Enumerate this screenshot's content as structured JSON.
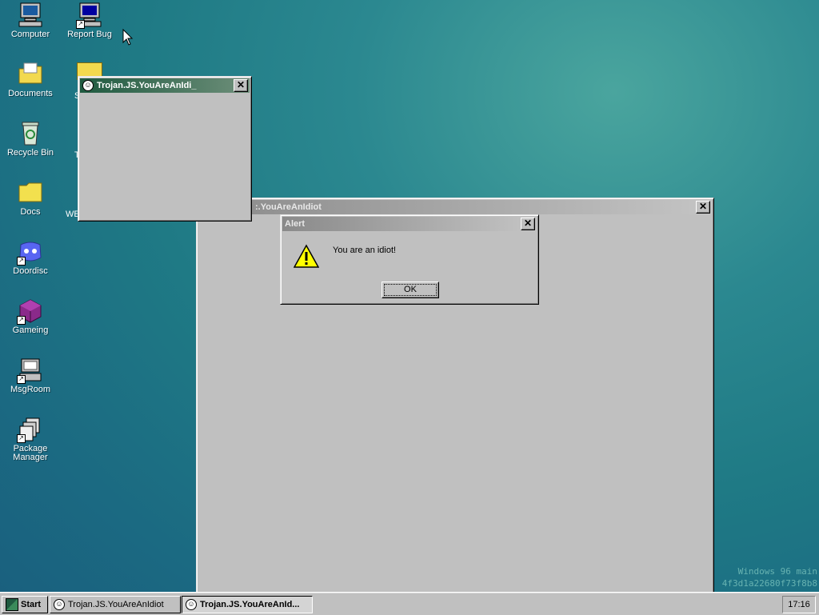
{
  "desktop": {
    "icons": [
      {
        "label": "Computer",
        "icon": "computer-icon"
      },
      {
        "label": "Report Bug",
        "icon": "report-bug-icon"
      },
      {
        "label": "Documents",
        "icon": "documents-folder-icon"
      },
      {
        "label": "Recycle Bin",
        "icon": "recycle-bin-icon"
      },
      {
        "label": "Docs",
        "icon": "folder-icon"
      },
      {
        "label": "Doordisc",
        "icon": "doordisc-icon"
      },
      {
        "label": "Gameing",
        "icon": "game-cube-icon"
      },
      {
        "label": "MsgRoom",
        "icon": "msgroom-icon"
      },
      {
        "label": "Package Manager",
        "icon": "package-manager-icon"
      }
    ],
    "partial_labels": [
      "S",
      "T",
      "WE"
    ]
  },
  "windows": {
    "small_popup": {
      "title": "Trojan.JS.YouAreAnIdi_"
    },
    "large_popup": {
      "title": ":.YouAreAnIdiot"
    },
    "alert": {
      "title": "Alert",
      "message": "You are an idiot!",
      "ok_label": "OK",
      "icon": "warning-icon"
    }
  },
  "taskbar": {
    "start_label": "Start",
    "tasks": [
      {
        "label": "Trojan.JS.YouAreAnIdiot",
        "active": false
      },
      {
        "label": "Trojan.JS.YouAreAnId...",
        "active": true
      }
    ],
    "clock": "17:16"
  },
  "watermark": {
    "line1": "Windows 96 main",
    "line2": "4f3d1a22680f73f8b8"
  },
  "colors": {
    "desktop": "#1f7a85",
    "active_title": "#1f5a40",
    "window_face": "#c0c0c0"
  }
}
